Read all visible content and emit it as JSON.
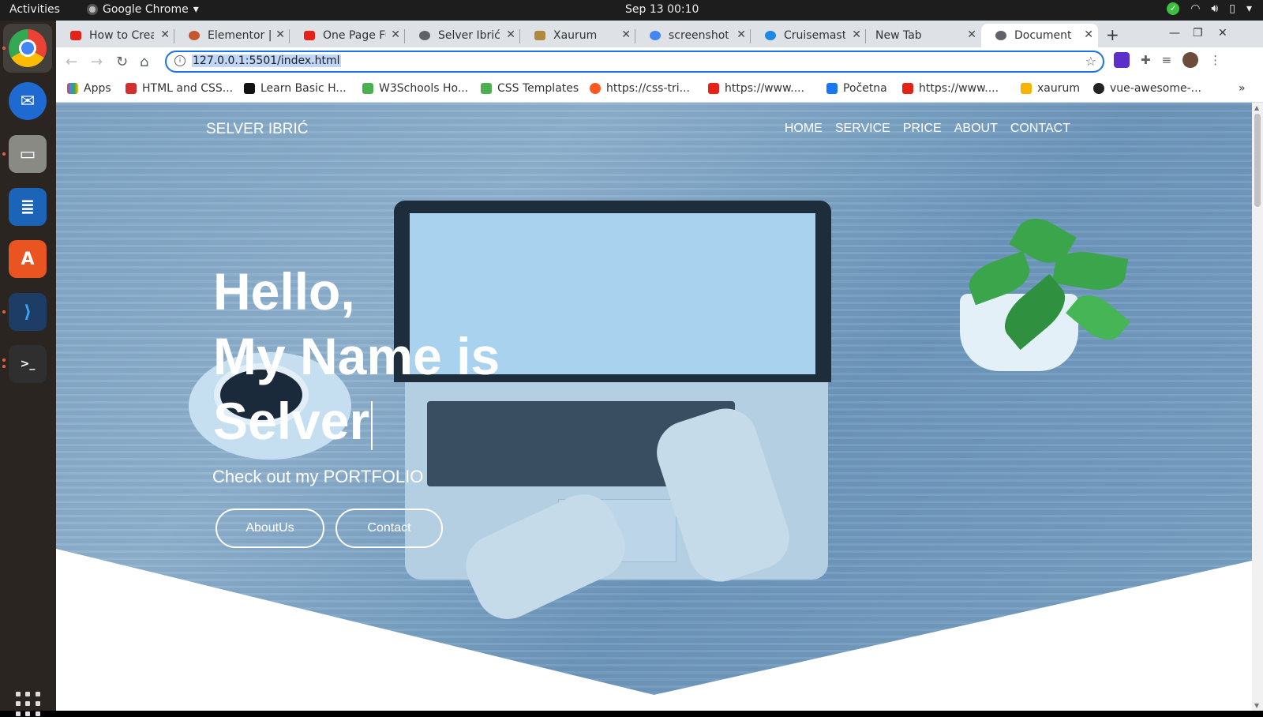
{
  "system": {
    "activities": "Activities",
    "app_name": "Google Chrome",
    "clock": "Sep 13  00:10"
  },
  "tabs": [
    {
      "title": "How to Crea",
      "favicon": "youtube-icon",
      "color": "#e62117"
    },
    {
      "title": "Elementor | I",
      "favicon": "elementor-icon",
      "color": "#c4572b"
    },
    {
      "title": "One Page Fu",
      "favicon": "youtube-icon",
      "color": "#e62117"
    },
    {
      "title": "Selver Ibrić",
      "favicon": "globe-icon",
      "color": "#5f6368"
    },
    {
      "title": "Xaurum",
      "favicon": "xaurum-icon",
      "color": "#b08a3c"
    },
    {
      "title": "screenshot",
      "favicon": "google-icon",
      "color": "#4285f4"
    },
    {
      "title": "Cruisemaste",
      "favicon": "cruisemaster-icon",
      "color": "#1e88e5"
    },
    {
      "title": "New Tab",
      "favicon": "",
      "color": ""
    },
    {
      "title": "Document",
      "favicon": "globe-icon",
      "color": "#5f6368"
    }
  ],
  "address": {
    "url": "127.0.0.1:5501/index.html"
  },
  "bookmarks": [
    {
      "label": "Apps",
      "color": "#ea4335"
    },
    {
      "label": "HTML and CSS...",
      "color": "#d32f2f"
    },
    {
      "label": "Learn Basic H...",
      "color": "#111111"
    },
    {
      "label": "W3Schools Ho...",
      "color": "#4caf50"
    },
    {
      "label": "CSS Templates",
      "color": "#4caf50"
    },
    {
      "label": "https://css-tri...",
      "color": "#ff5722"
    },
    {
      "label": "https://www....",
      "color": "#e62117"
    },
    {
      "label": "Početna",
      "color": "#1877f2"
    },
    {
      "label": "https://www....",
      "color": "#e62117"
    },
    {
      "label": "xaurum",
      "color": "#f5b400"
    },
    {
      "label": "vue-awesome-...",
      "color": "#222222"
    }
  ],
  "site": {
    "brand": "SELVER IBRIĆ",
    "nav": [
      "HOME",
      "SERVICE",
      "PRICE",
      "ABOUT",
      "CONTACT"
    ],
    "headline_1": "Hello,",
    "headline_2": "My Name is",
    "headline_3": "Selver",
    "tagline": "Check out my PORTFOLIO",
    "btn_about": "AboutUs",
    "btn_contact": "Contact"
  }
}
